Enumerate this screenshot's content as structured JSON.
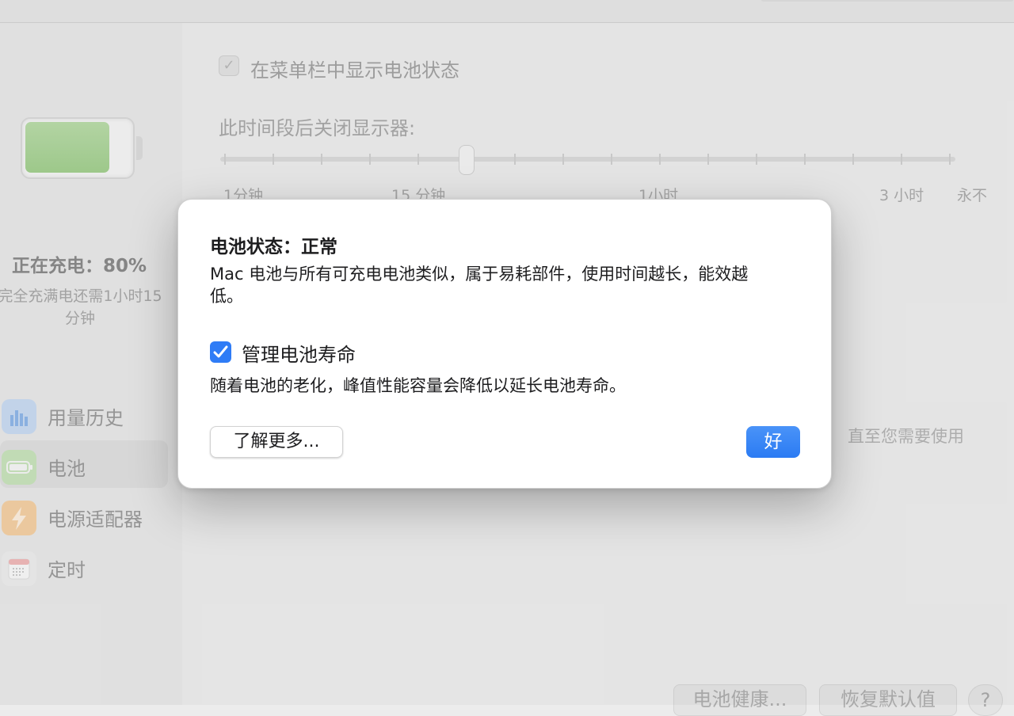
{
  "sidebar": {
    "charge_status": "正在充电：80%",
    "charge_remaining": "完全充满电还需1小时15分钟",
    "battery_level_fraction": 0.8,
    "items": [
      {
        "label": "用量历史",
        "icon": "chart-bar-icon",
        "color": "#8fb6e8"
      },
      {
        "label": "电池",
        "icon": "battery-icon",
        "color": "#a3d08c"
      },
      {
        "label": "电源适配器",
        "icon": "lightning-icon",
        "color": "#f0b46a"
      },
      {
        "label": "定时",
        "icon": "calendar-icon",
        "color": "#e5e5e5"
      }
    ]
  },
  "main": {
    "menu_bar_checkbox_label": "在菜单栏中显示电池状态",
    "menu_bar_checked": true,
    "slider_label": "此时间段后关闭显示器:",
    "slider_tick_labels": [
      "1分钟",
      "15 分钟",
      "1小时",
      "3 小时",
      "永不"
    ],
    "hint_text": "直至您需要使用",
    "battery_health_button": "电池健康...",
    "restore_defaults_button": "恢复默认值",
    "help_button": "?"
  },
  "dialog": {
    "title": "电池状态：正常",
    "description": "Mac 电池与所有可充电电池类似，属于易耗部件，使用时间越长，能效越低。",
    "manage_label": "管理电池寿命",
    "manage_checked": true,
    "manage_description": "随着电池的老化，峰值性能容量会降低以延长电池寿命。",
    "learn_more_button": "了解更多...",
    "ok_button": "好"
  },
  "colors": {
    "accent": "#2f7cf6",
    "battery_fill": "#a3cf8f"
  }
}
